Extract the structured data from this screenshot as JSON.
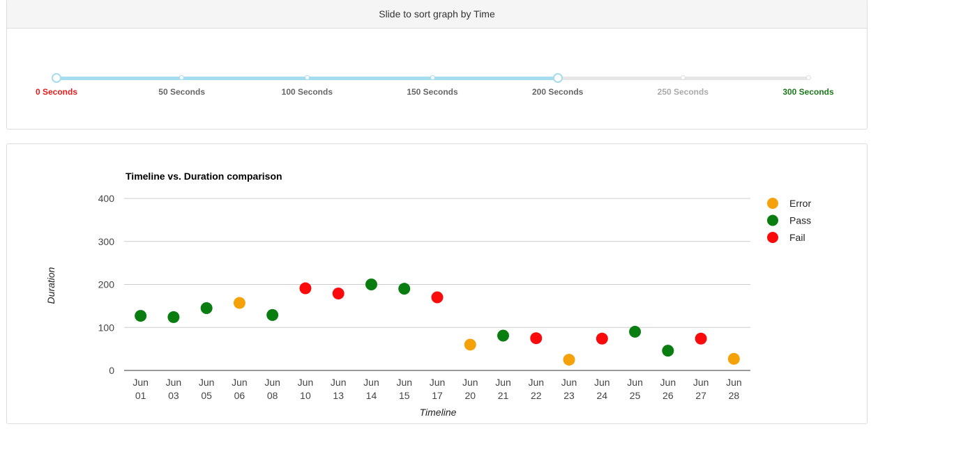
{
  "slider": {
    "heading": "Slide to sort graph by Time",
    "labels": [
      {
        "text": "0 Seconds",
        "color": "#e31b1b"
      },
      {
        "text": "50 Seconds",
        "color": "#666666"
      },
      {
        "text": "100 Seconds",
        "color": "#666666"
      },
      {
        "text": "150 Seconds",
        "color": "#666666"
      },
      {
        "text": "200 Seconds",
        "color": "#666666"
      },
      {
        "text": "250 Seconds",
        "color": "#aaaaaa"
      },
      {
        "text": "300 Seconds",
        "color": "#1a7a1a"
      }
    ],
    "range_seconds": [
      0,
      200
    ],
    "max_seconds": 300,
    "step_seconds": 50,
    "fill_color": "#a6dcf0"
  },
  "chart_data": {
    "type": "scatter",
    "title": "Timeline vs. Duration comparison",
    "xlabel": "Timeline",
    "ylabel": "Duration",
    "ylim": [
      0,
      400
    ],
    "yticks": [
      0,
      100,
      200,
      300,
      400
    ],
    "grid": true,
    "legend_position": "right",
    "categories": [
      {
        "top": "Jun",
        "bottom": "01"
      },
      {
        "top": "Jun",
        "bottom": "03"
      },
      {
        "top": "Jun",
        "bottom": "05"
      },
      {
        "top": "Jun",
        "bottom": "06"
      },
      {
        "top": "Jun",
        "bottom": "08"
      },
      {
        "top": "Jun",
        "bottom": "10"
      },
      {
        "top": "Jun",
        "bottom": "13"
      },
      {
        "top": "Jun",
        "bottom": "14"
      },
      {
        "top": "Jun",
        "bottom": "15"
      },
      {
        "top": "Jun",
        "bottom": "17"
      },
      {
        "top": "Jun",
        "bottom": "20"
      },
      {
        "top": "Jun",
        "bottom": "21"
      },
      {
        "top": "Jun",
        "bottom": "22"
      },
      {
        "top": "Jun",
        "bottom": "23"
      },
      {
        "top": "Jun",
        "bottom": "24"
      },
      {
        "top": "Jun",
        "bottom": "25"
      },
      {
        "top": "Jun",
        "bottom": "26"
      },
      {
        "top": "Jun",
        "bottom": "27"
      },
      {
        "top": "Jun",
        "bottom": "28"
      }
    ],
    "series": [
      {
        "name": "Error",
        "color": "#f5a20a",
        "points": [
          {
            "x": "Jun 06",
            "y": 157
          },
          {
            "x": "Jun 20",
            "y": 60
          },
          {
            "x": "Jun 23",
            "y": 25
          },
          {
            "x": "Jun 28",
            "y": 27
          }
        ]
      },
      {
        "name": "Pass",
        "color": "#0a7d10",
        "points": [
          {
            "x": "Jun 01",
            "y": 127
          },
          {
            "x": "Jun 03",
            "y": 124
          },
          {
            "x": "Jun 05",
            "y": 145
          },
          {
            "x": "Jun 08",
            "y": 129
          },
          {
            "x": "Jun 14",
            "y": 200
          },
          {
            "x": "Jun 15",
            "y": 190
          },
          {
            "x": "Jun 21",
            "y": 81
          },
          {
            "x": "Jun 25",
            "y": 90
          },
          {
            "x": "Jun 26",
            "y": 46
          }
        ]
      },
      {
        "name": "Fail",
        "color": "#fa0a0a",
        "points": [
          {
            "x": "Jun 10",
            "y": 191
          },
          {
            "x": "Jun 13",
            "y": 179
          },
          {
            "x": "Jun 17",
            "y": 170
          },
          {
            "x": "Jun 22",
            "y": 75
          },
          {
            "x": "Jun 24",
            "y": 74
          },
          {
            "x": "Jun 27",
            "y": 74
          }
        ]
      }
    ]
  }
}
